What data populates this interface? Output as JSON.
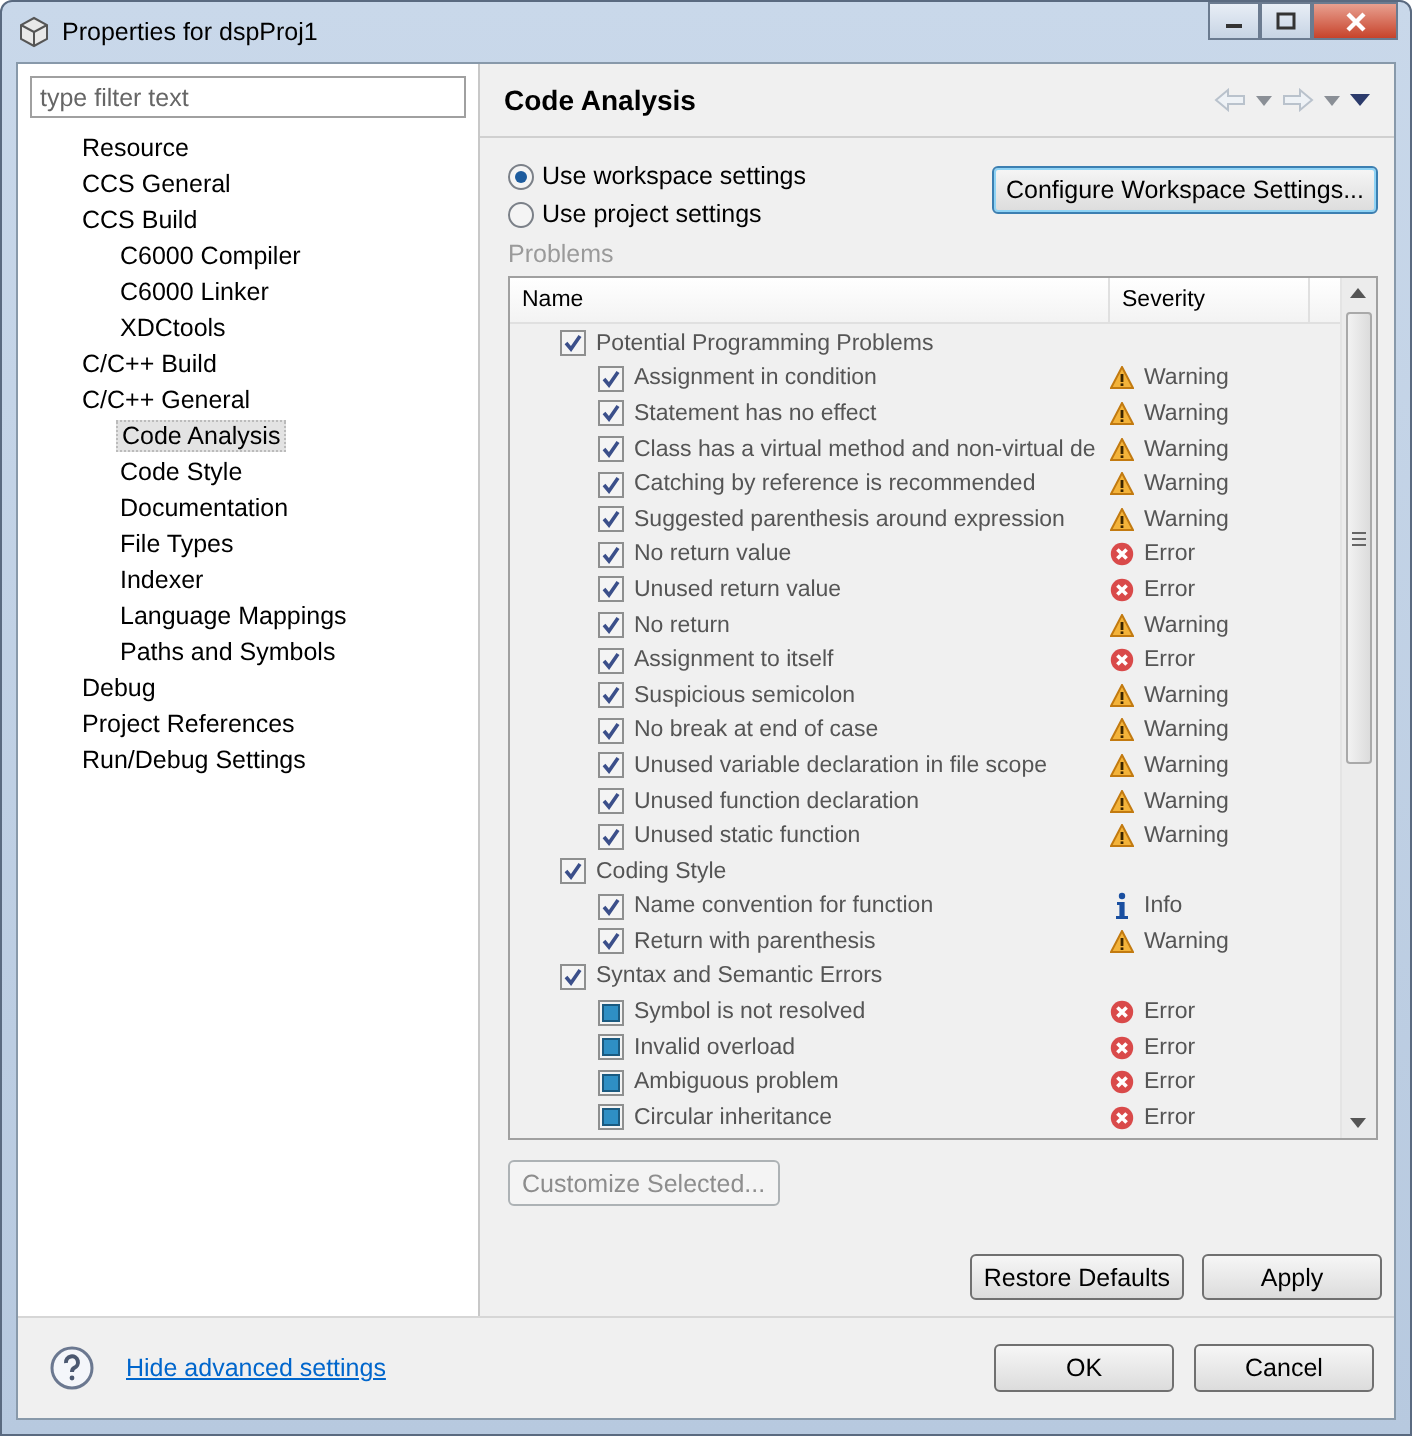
{
  "window": {
    "title": "Properties for dspProj1"
  },
  "filter": {
    "placeholder": "type filter text"
  },
  "tree": [
    {
      "label": "Resource",
      "selected": false
    },
    {
      "label": "CCS General",
      "selected": false
    },
    {
      "label": "CCS Build",
      "selected": false,
      "children": [
        {
          "label": "C6000 Compiler",
          "selected": false
        },
        {
          "label": "C6000 Linker",
          "selected": false
        },
        {
          "label": "XDCtools",
          "selected": false
        }
      ]
    },
    {
      "label": "C/C++ Build",
      "selected": false
    },
    {
      "label": "C/C++ General",
      "selected": false,
      "children": [
        {
          "label": "Code Analysis",
          "selected": true
        },
        {
          "label": "Code Style",
          "selected": false
        },
        {
          "label": "Documentation",
          "selected": false
        },
        {
          "label": "File Types",
          "selected": false
        },
        {
          "label": "Indexer",
          "selected": false
        },
        {
          "label": "Language Mappings",
          "selected": false
        },
        {
          "label": "Paths and Symbols",
          "selected": false
        }
      ]
    },
    {
      "label": "Debug",
      "selected": false
    },
    {
      "label": "Project References",
      "selected": false
    },
    {
      "label": "Run/Debug Settings",
      "selected": false
    }
  ],
  "page": {
    "title": "Code Analysis"
  },
  "settings_options": [
    {
      "label": "Use workspace settings",
      "selected": true
    },
    {
      "label": "Use project settings",
      "selected": false
    }
  ],
  "configure_button": "Configure Workspace Settings...",
  "problems": {
    "label": "Problems",
    "disabled": true,
    "columns": [
      "Name",
      "Severity"
    ],
    "rows": [
      {
        "name": "Potential Programming Problems",
        "checked": true,
        "mixed": false,
        "children": [
          {
            "name": "Assignment in condition",
            "checked": true,
            "mixed": false,
            "kind": "warning",
            "severity": "Warning"
          },
          {
            "name": "Statement has no effect",
            "checked": true,
            "mixed": false,
            "kind": "warning",
            "severity": "Warning"
          },
          {
            "name": "Class has a virtual method and non-virtual de",
            "checked": true,
            "mixed": false,
            "kind": "warning",
            "severity": "Warning"
          },
          {
            "name": "Catching by reference is recommended",
            "checked": true,
            "mixed": false,
            "kind": "warning",
            "severity": "Warning"
          },
          {
            "name": "Suggested parenthesis around expression",
            "checked": true,
            "mixed": false,
            "kind": "warning",
            "severity": "Warning"
          },
          {
            "name": "No return value",
            "checked": true,
            "mixed": false,
            "kind": "error",
            "severity": "Error"
          },
          {
            "name": "Unused return value",
            "checked": true,
            "mixed": false,
            "kind": "error",
            "severity": "Error"
          },
          {
            "name": "No return",
            "checked": true,
            "mixed": false,
            "kind": "warning",
            "severity": "Warning"
          },
          {
            "name": "Assignment to itself",
            "checked": true,
            "mixed": false,
            "kind": "error",
            "severity": "Error"
          },
          {
            "name": "Suspicious semicolon",
            "checked": true,
            "mixed": false,
            "kind": "warning",
            "severity": "Warning"
          },
          {
            "name": "No break at end of case",
            "checked": true,
            "mixed": false,
            "kind": "warning",
            "severity": "Warning"
          },
          {
            "name": "Unused variable declaration in file scope",
            "checked": true,
            "mixed": false,
            "kind": "warning",
            "severity": "Warning"
          },
          {
            "name": "Unused function declaration",
            "checked": true,
            "mixed": false,
            "kind": "warning",
            "severity": "Warning"
          },
          {
            "name": "Unused static function",
            "checked": true,
            "mixed": false,
            "kind": "warning",
            "severity": "Warning"
          }
        ]
      },
      {
        "name": "Coding Style",
        "checked": true,
        "mixed": false,
        "children": [
          {
            "name": "Name convention for function",
            "checked": true,
            "mixed": false,
            "kind": "info",
            "severity": "Info"
          },
          {
            "name": "Return with parenthesis",
            "checked": true,
            "mixed": false,
            "kind": "warning",
            "severity": "Warning"
          }
        ]
      },
      {
        "name": "Syntax and Semantic Errors",
        "checked": true,
        "mixed": false,
        "children": [
          {
            "name": "Symbol is not resolved",
            "checked": false,
            "mixed": true,
            "kind": "error",
            "severity": "Error"
          },
          {
            "name": "Invalid overload",
            "checked": false,
            "mixed": true,
            "kind": "error",
            "severity": "Error"
          },
          {
            "name": "Ambiguous problem",
            "checked": false,
            "mixed": true,
            "kind": "error",
            "severity": "Error"
          },
          {
            "name": "Circular inheritance",
            "checked": false,
            "mixed": true,
            "kind": "error",
            "severity": "Error"
          }
        ]
      }
    ]
  },
  "customize_button": {
    "label": "Customize Selected...",
    "disabled": true
  },
  "page_buttons": [
    "Restore Defaults",
    "Apply"
  ],
  "footer": {
    "link": "Hide advanced settings",
    "buttons": [
      "OK",
      "Cancel"
    ]
  }
}
